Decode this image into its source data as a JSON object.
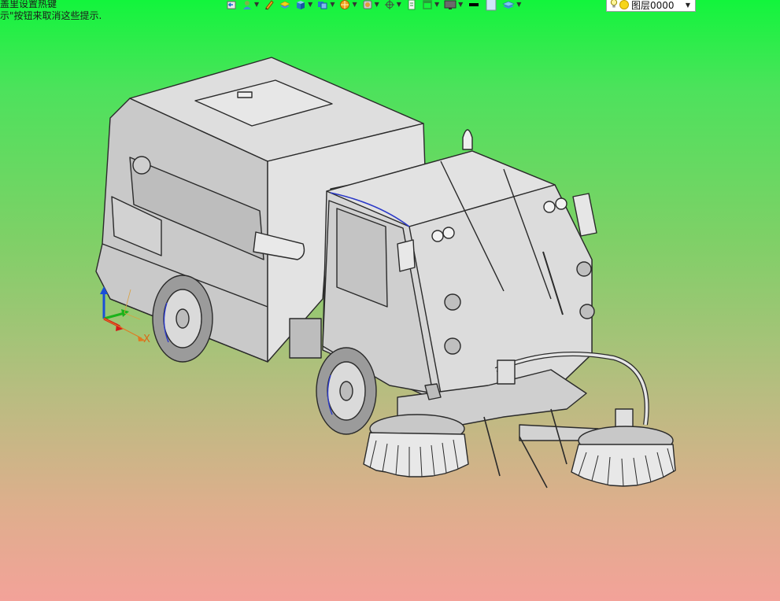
{
  "hints": {
    "line1": "盖里设置热键",
    "line2": "示\"按钮来取消这些提示."
  },
  "toolbar": {
    "buttons": [
      {
        "name": "undo-icon",
        "icon": "arrow-left"
      },
      {
        "name": "user-icon",
        "icon": "user"
      },
      {
        "name": "pen-icon",
        "icon": "pen"
      },
      {
        "name": "layer-stack-icon",
        "icon": "stack"
      },
      {
        "name": "cube-icon",
        "icon": "cube"
      },
      {
        "name": "cubes-icon",
        "icon": "cubes"
      },
      {
        "name": "render-sphere-icon",
        "icon": "sphere"
      },
      {
        "name": "material-icon",
        "icon": "material"
      },
      {
        "name": "transform-icon",
        "icon": "crosshair"
      },
      {
        "name": "page-icon",
        "icon": "page"
      },
      {
        "name": "frame-icon",
        "icon": "frame"
      },
      {
        "name": "monitor-icon",
        "icon": "monitor"
      },
      {
        "name": "line-color-swatch",
        "icon": "black-line"
      },
      {
        "name": "fill-color-swatch",
        "icon": "light-blue"
      },
      {
        "name": "layers-icon",
        "icon": "layers"
      }
    ]
  },
  "layer": {
    "label": "图层0000"
  },
  "triad": {
    "x_label": "X"
  },
  "colors": {
    "bg_top": "#12f53c",
    "bg_bottom": "#f3a299",
    "model_fill": "#d9d9d9",
    "model_stroke": "#2a2a2a",
    "edge_highlight": "#2b39c8"
  }
}
